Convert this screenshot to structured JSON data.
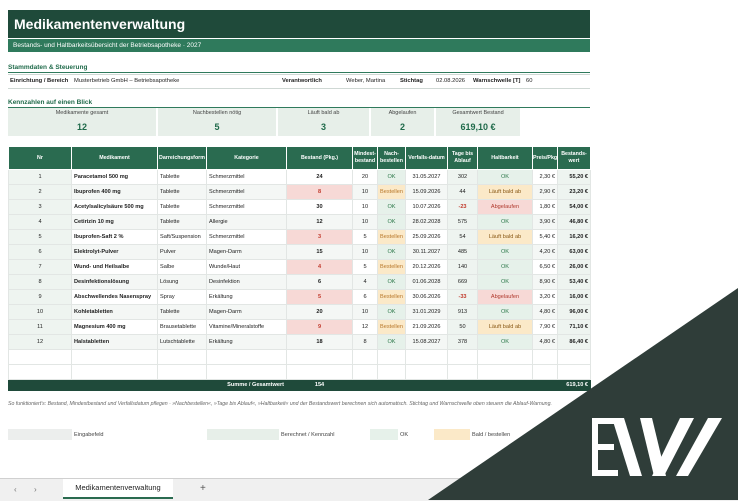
{
  "title": "Medikamentenverwaltung",
  "subtitle": "Bestands- und Haltbarkeitsübersicht der Betriebsapotheke · 2027",
  "stamm": {
    "section": "Stammdaten & Steuerung",
    "label_einrichtung": "Einrichtung / Bereich",
    "value_einrichtung": "Musterbetrieb GmbH – Betriebsapotheke",
    "label_verantwortlich": "Verantwortlich",
    "value_verantwortlich": "Weber, Martina",
    "label_stichtag": "Stichtag",
    "value_stichtag": "02.08.2026",
    "label_warn": "Warnschwelle [T]",
    "value_warn": "60"
  },
  "kpi": {
    "section": "Kennzahlen auf einen Blick",
    "items": [
      {
        "label": "Medikamente gesamt",
        "value": "12"
      },
      {
        "label": "Nachbestellen nötig",
        "value": "5"
      },
      {
        "label": "Läuft bald ab",
        "value": "3"
      },
      {
        "label": "Abgelaufen",
        "value": "2"
      },
      {
        "label": "Gesamtwert Bestand",
        "value": "619,10 €"
      }
    ]
  },
  "table": {
    "headers": [
      "Nr",
      "Medikament",
      "Darreichungsform",
      "Kategorie",
      "Bestand (Pkg.)",
      "Mindest-bestand",
      "Nach-bestellen",
      "Verfalls-datum",
      "Tage bis Ablauf",
      "Haltbarkeit",
      "Preis/Pkg",
      "Bestands-wert"
    ],
    "rows": [
      {
        "nr": "1",
        "name": "Paracetamol 500 mg",
        "form": "Tablette",
        "kat": "Schmerzmittel",
        "bestand": "24",
        "min": "20",
        "nach": "OK",
        "datum": "31.05.2027",
        "tage": "302",
        "halt": "OK",
        "preis": "2,30 €",
        "wert": "55,20 €"
      },
      {
        "nr": "2",
        "name": "Ibuprofen 400 mg",
        "form": "Tablette",
        "kat": "Schmerzmittel",
        "bestand": "8",
        "min": "10",
        "nach": "Bestellen",
        "datum": "15.09.2026",
        "tage": "44",
        "halt": "Läuft bald ab",
        "preis": "2,90 €",
        "wert": "23,20 €"
      },
      {
        "nr": "3",
        "name": "Acetylsalicylsäure 500 mg",
        "form": "Tablette",
        "kat": "Schmerzmittel",
        "bestand": "30",
        "min": "10",
        "nach": "OK",
        "datum": "10.07.2026",
        "tage": "-23",
        "halt": "Abgelaufen",
        "preis": "1,80 €",
        "wert": "54,00 €"
      },
      {
        "nr": "4",
        "name": "Cetirizin 10 mg",
        "form": "Tablette",
        "kat": "Allergie",
        "bestand": "12",
        "min": "10",
        "nach": "OK",
        "datum": "28.02.2028",
        "tage": "575",
        "halt": "OK",
        "preis": "3,90 €",
        "wert": "46,80 €"
      },
      {
        "nr": "5",
        "name": "Ibuprofen-Saft 2 %",
        "form": "Saft/Suspension",
        "kat": "Schmerzmittel",
        "bestand": "3",
        "min": "5",
        "nach": "Bestellen",
        "datum": "25.09.2026",
        "tage": "54",
        "halt": "Läuft bald ab",
        "preis": "5,40 €",
        "wert": "16,20 €"
      },
      {
        "nr": "6",
        "name": "Elektrolyt-Pulver",
        "form": "Pulver",
        "kat": "Magen-Darm",
        "bestand": "15",
        "min": "10",
        "nach": "OK",
        "datum": "30.11.2027",
        "tage": "485",
        "halt": "OK",
        "preis": "4,20 €",
        "wert": "63,00 €"
      },
      {
        "nr": "7",
        "name": "Wund- und Heilsalbe",
        "form": "Salbe",
        "kat": "Wunde/Haut",
        "bestand": "4",
        "min": "5",
        "nach": "Bestellen",
        "datum": "20.12.2026",
        "tage": "140",
        "halt": "OK",
        "preis": "6,50 €",
        "wert": "26,00 €"
      },
      {
        "nr": "8",
        "name": "Desinfektionslösung",
        "form": "Lösung",
        "kat": "Desinfektion",
        "bestand": "6",
        "min": "4",
        "nach": "OK",
        "datum": "01.06.2028",
        "tage": "669",
        "halt": "OK",
        "preis": "8,90 €",
        "wert": "53,40 €"
      },
      {
        "nr": "9",
        "name": "Abschwellendes Nasenspray",
        "form": "Spray",
        "kat": "Erkältung",
        "bestand": "5",
        "min": "6",
        "nach": "Bestellen",
        "datum": "30.06.2026",
        "tage": "-33",
        "halt": "Abgelaufen",
        "preis": "3,20 €",
        "wert": "16,00 €"
      },
      {
        "nr": "10",
        "name": "Kohletabletten",
        "form": "Tablette",
        "kat": "Magen-Darm",
        "bestand": "20",
        "min": "10",
        "nach": "OK",
        "datum": "31.01.2029",
        "tage": "913",
        "halt": "OK",
        "preis": "4,80 €",
        "wert": "96,00 €"
      },
      {
        "nr": "11",
        "name": "Magnesium 400 mg",
        "form": "Brausetablette",
        "kat": "Vitamine/Mineralstoffe",
        "bestand": "9",
        "min": "12",
        "nach": "Bestellen",
        "datum": "21.09.2026",
        "tage": "50",
        "halt": "Läuft bald ab",
        "preis": "7,90 €",
        "wert": "71,10 €"
      },
      {
        "nr": "12",
        "name": "Halstabletten",
        "form": "Lutschtablette",
        "kat": "Erkältung",
        "bestand": "18",
        "min": "8",
        "nach": "OK",
        "datum": "15.08.2027",
        "tage": "378",
        "halt": "OK",
        "preis": "4,80 €",
        "wert": "86,40 €"
      }
    ],
    "sum_label": "Summe / Gesamtwert",
    "sum_bestand": "154",
    "sum_wert": "619,10 €"
  },
  "note": "So funktioniert's: Bestand, Mindestbestand und Verfallsdatum pflegen · »Nachbestellen«, »Tage bis Ablauf«, »Haltbarkeit« und der Bestandswert berechnen sich automatisch. Stichtag und Warnschwelle oben steuern die Ablauf-Warnung.",
  "legend": [
    {
      "label": "Eingabefeld",
      "color": "#eceeed"
    },
    {
      "label": "Berechnet / Kennzahl",
      "color": "#e7efe9"
    },
    {
      "label": "OK",
      "color": "#e6f1ea"
    },
    {
      "label": "Bald / bestellen",
      "color": "#fbe9c8"
    }
  ],
  "sheet_tab": "Medikamentenverwaltung",
  "watermark": "EW",
  "colors": {
    "header": "#1f4a3a",
    "accent": "#2a6b50",
    "overlay": "#2f3d39"
  }
}
